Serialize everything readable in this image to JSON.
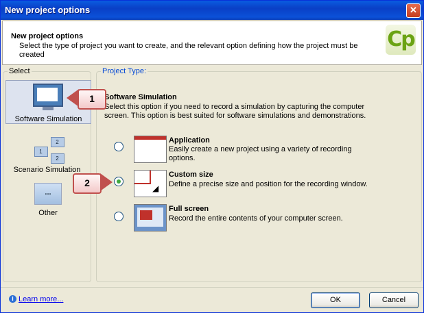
{
  "window": {
    "title": "New project options"
  },
  "header": {
    "title": "New project options",
    "subtitle": "Select the type of project you want to create, and the relevant option defining how the project must be created",
    "logo_text": "Cp"
  },
  "select_panel": {
    "label": "Select",
    "items": [
      {
        "label": "Software Simulation",
        "icon": "monitor-icon",
        "selected": true
      },
      {
        "label": "Scenario Simulation",
        "icon": "scenario-icon",
        "selected": false
      },
      {
        "label": "Other",
        "icon": "other-icon",
        "selected": false
      }
    ]
  },
  "project_type": {
    "label": "Project Type:",
    "title": "Software Simulation",
    "description": "Select this option if you need to record a simulation by capturing the computer screen. This option is best suited for software simulations and demonstrations.",
    "options": [
      {
        "title": "Application",
        "description": "Easily create a new project using a variety of recording options.",
        "selected": false
      },
      {
        "title": "Custom size",
        "description": "Define a precise size and position for the recording window.",
        "selected": true
      },
      {
        "title": "Full screen",
        "description": "Record the entire contents of your computer screen.",
        "selected": false
      }
    ]
  },
  "callouts": {
    "one": "1",
    "two": "2"
  },
  "footer": {
    "learn_more": "Learn more...",
    "ok": "OK",
    "cancel": "Cancel"
  },
  "colors": {
    "titlebar": "#0a3fc6",
    "callout_border": "#c0504d",
    "radio_selected": "#3ea83e",
    "link": "#0000ee"
  }
}
